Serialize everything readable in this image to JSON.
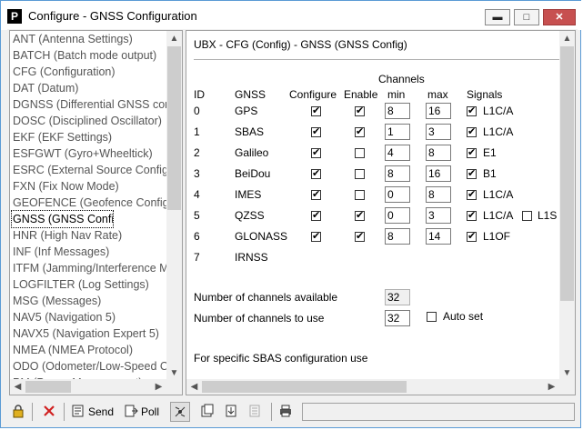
{
  "window": {
    "title": "Configure - GNSS Configuration",
    "app_icon": "P",
    "controls": {
      "minimize": "▬",
      "maximize": "□",
      "close": "✕"
    }
  },
  "message_list": {
    "items": [
      "ANT (Antenna Settings)",
      "BATCH (Batch mode output)",
      "CFG (Configuration)",
      "DAT (Datum)",
      "DGNSS (Differential GNSS conf",
      "DOSC (Disciplined Oscillator)",
      "EKF (EKF Settings)",
      "ESFGWT (Gyro+Wheeltick)",
      "ESRC (External Source Config)",
      "FXN (Fix Now Mode)",
      "GEOFENCE (Geofence Config)",
      "GNSS (GNSS Config)",
      "HNR (High Nav Rate)",
      "INF (Inf Messages)",
      "ITFM (Jamming/Interference M",
      "LOGFILTER (Log Settings)",
      "MSG (Messages)",
      "NAV5 (Navigation 5)",
      "NAVX5 (Navigation Expert 5)",
      "NMEA (NMEA Protocol)",
      "ODO (Odometer/Low-Speed C",
      "PM (Power Management)"
    ],
    "selected_index": 11
  },
  "panel": {
    "title": "UBX - CFG (Config) - GNSS (GNSS Config)",
    "headers": {
      "id": "ID",
      "gnss": "GNSS",
      "configure": "Configure",
      "enable": "Enable",
      "channels": "Channels",
      "min": "min",
      "max": "max",
      "signals": "Signals"
    },
    "rows": [
      {
        "id": "0",
        "gnss": "GPS",
        "configure": true,
        "enable": true,
        "min": "8",
        "max": "16",
        "signal": "L1C/A",
        "signal_checked": true
      },
      {
        "id": "1",
        "gnss": "SBAS",
        "configure": true,
        "enable": true,
        "min": "1",
        "max": "3",
        "signal": "L1C/A",
        "signal_checked": true
      },
      {
        "id": "2",
        "gnss": "Galileo",
        "configure": true,
        "enable": false,
        "min": "4",
        "max": "8",
        "signal": "E1",
        "signal_checked": true
      },
      {
        "id": "3",
        "gnss": "BeiDou",
        "configure": true,
        "enable": false,
        "min": "8",
        "max": "16",
        "signal": "B1",
        "signal_checked": true
      },
      {
        "id": "4",
        "gnss": "IMES",
        "configure": true,
        "enable": false,
        "min": "0",
        "max": "8",
        "signal": "L1C/A",
        "signal_checked": true
      },
      {
        "id": "5",
        "gnss": "QZSS",
        "configure": true,
        "enable": true,
        "min": "0",
        "max": "3",
        "signal": "L1C/A",
        "signal_checked": true,
        "signal2": "L1S",
        "signal2_checked": false
      },
      {
        "id": "6",
        "gnss": "GLONASS",
        "configure": true,
        "enable": true,
        "min": "8",
        "max": "14",
        "signal": "L1OF",
        "signal_checked": true
      },
      {
        "id": "7",
        "gnss": "IRNSS"
      }
    ],
    "channels_available_label": "Number of channels available",
    "channels_available": "32",
    "channels_to_use_label": "Number of channels to use",
    "channels_to_use": "32",
    "auto_set_label": "Auto set",
    "auto_set_checked": false,
    "footer_text": "For specific SBAS configuration use"
  },
  "toolbar": {
    "send_label": "Send",
    "poll_label": "Poll"
  },
  "check_glyph": "✔"
}
